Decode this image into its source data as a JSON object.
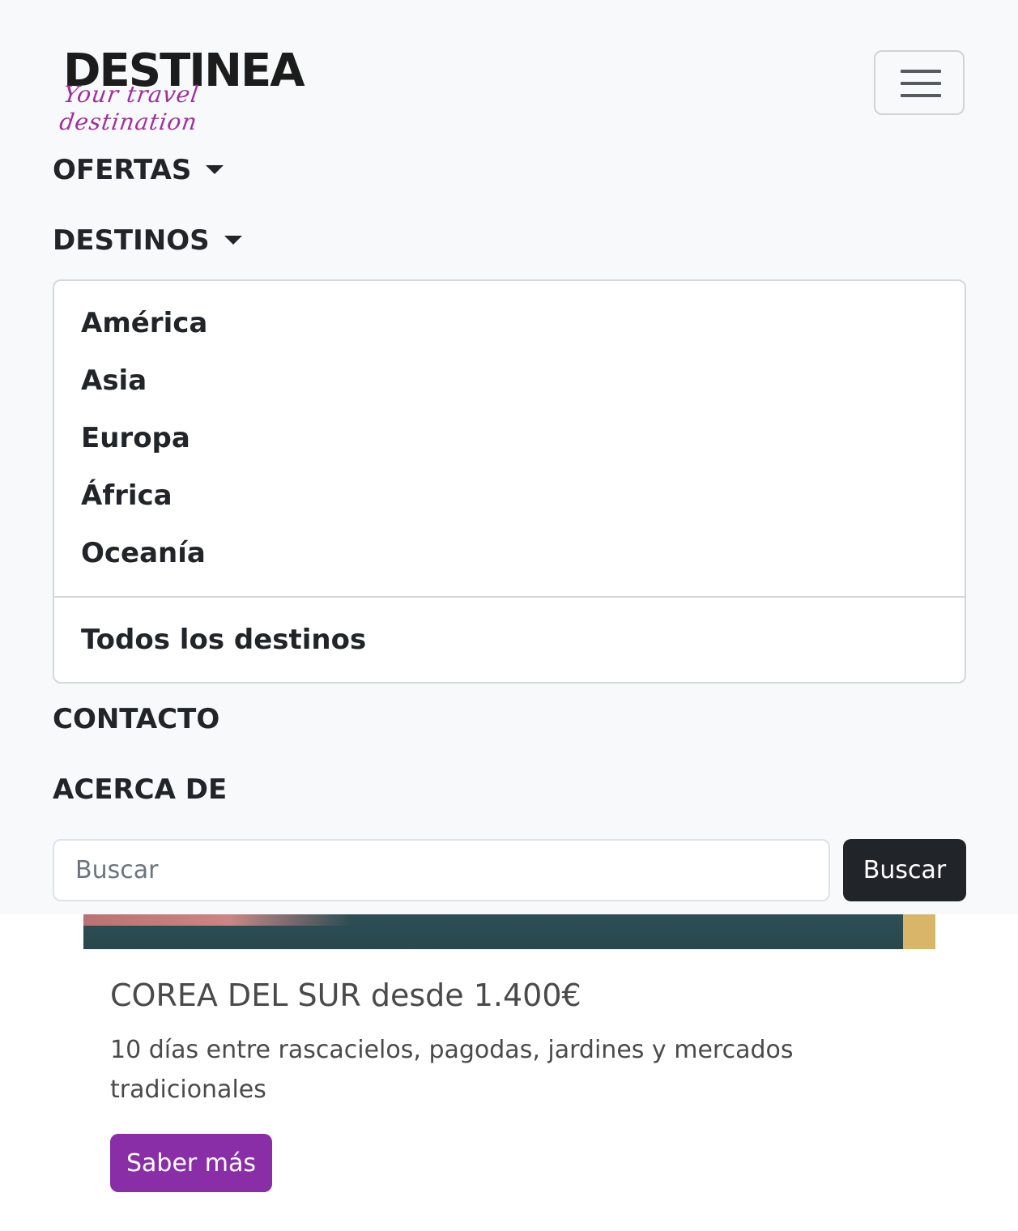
{
  "brand": {
    "name": "DESTINEA",
    "tagline": "Your travel destination"
  },
  "nav": {
    "toggler_icon": "hamburger-icon",
    "items": [
      {
        "label": "OFERTAS"
      },
      {
        "label": "DESTINOS"
      },
      {
        "label": "CONTACTO"
      },
      {
        "label": "ACERCA DE"
      }
    ],
    "dropdown": {
      "items": [
        "América",
        "Asia",
        "Europa",
        "África",
        "Oceanía"
      ],
      "footer_item": "Todos los destinos"
    }
  },
  "search": {
    "placeholder": "Buscar",
    "button_label": "Buscar"
  },
  "card": {
    "title": "COREA DEL SUR desde 1.400€",
    "text": "10 días entre rascacielos, pagodas, jardines y mercados tradicionales",
    "button_label": "Saber más"
  },
  "colors": {
    "navbar_bg": "#f8f9fa",
    "dark_button": "#212529",
    "accent_purple": "#8a2ea8"
  }
}
